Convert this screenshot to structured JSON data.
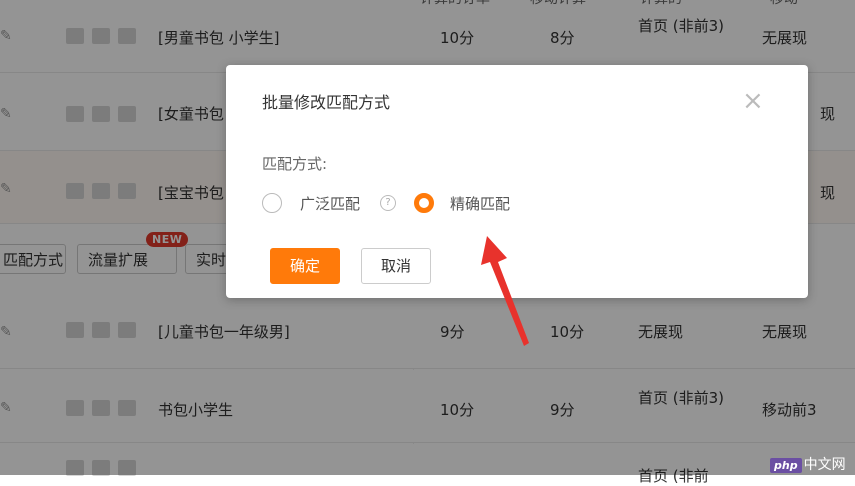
{
  "table": {
    "header_fragments": [
      "计算的订单",
      "移动计算",
      "计算的",
      "移动"
    ],
    "rows": [
      {
        "keyword": "[男童书包 小学生]",
        "pc_score": "10分",
        "mobile_score": "8分",
        "pc_rank": "首页 (非前3)",
        "mobile_rank": "无展现",
        "highlight": false
      },
      {
        "keyword": "[女童书包",
        "pc_score": "",
        "mobile_score": "",
        "pc_rank": "",
        "mobile_rank": "现",
        "highlight": false
      },
      {
        "keyword": "[宝宝书包",
        "pc_score": "",
        "mobile_score": "",
        "pc_rank": "",
        "mobile_rank": "现",
        "highlight": true
      },
      {
        "keyword": "[儿童书包一年级男]",
        "pc_score": "9分",
        "mobile_score": "10分",
        "pc_rank": "无展现",
        "mobile_rank": "无展现",
        "highlight": false
      },
      {
        "keyword": "书包小学生",
        "pc_score": "10分",
        "mobile_score": "9分",
        "pc_rank": "首页 (非前3)",
        "mobile_rank": "移动前3",
        "highlight": false
      },
      {
        "keyword": "",
        "pc_score": "",
        "mobile_score": "",
        "pc_rank": "首页 (非前",
        "mobile_rank": "",
        "highlight": false
      }
    ]
  },
  "toolbar": {
    "match_mode_btn": "匹配方式",
    "traffic_btn": "流量扩展",
    "realtime_btn": "实时",
    "new_badge": "NEW"
  },
  "modal": {
    "title": "批量修改匹配方式",
    "close_icon": "close-icon",
    "field_label": "匹配方式:",
    "options": [
      {
        "label": "广泛匹配",
        "checked": false,
        "help": "?"
      },
      {
        "label": "精确匹配",
        "checked": true
      }
    ],
    "confirm_label": "确定",
    "cancel_label": "取消"
  },
  "colors": {
    "accent": "#ff7a0a",
    "arrow": "#e8322c",
    "badge": "#e23a2c"
  },
  "watermark": {
    "badge": "php",
    "text": "中文网"
  }
}
